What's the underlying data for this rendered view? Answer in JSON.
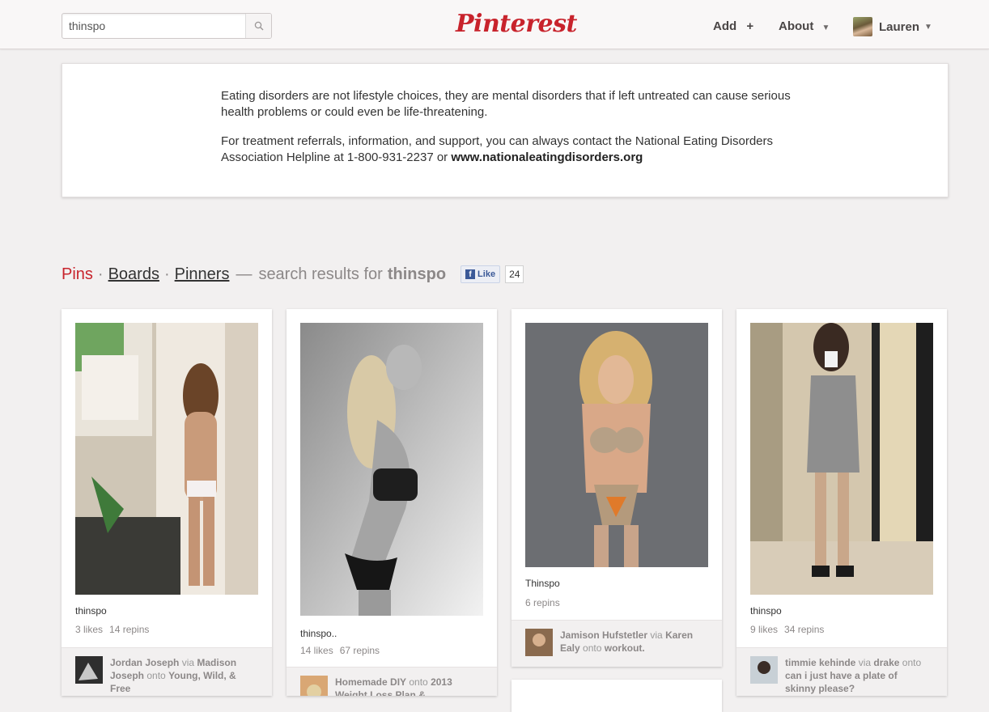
{
  "header": {
    "search_value": "thinspo",
    "search_icon": "search-icon",
    "logo": "Pinterest",
    "nav": {
      "add_label": "Add",
      "add_icon": "+",
      "about_label": "About",
      "user_name": "Lauren"
    }
  },
  "notice": {
    "para1": "Eating disorders are not lifestyle choices, they are mental disorders that if left untreated can cause serious health problems or could even be life-threatening.",
    "para2_text": "For treatment referrals, information, and support, you can always contact the National Eating Disorders Association Helpline at 1-800-931-2237 or ",
    "para2_link": "www.nationaleatingdisorders.org"
  },
  "results": {
    "tab_pins": "Pins",
    "tab_boards": "Boards",
    "tab_pinners": "Pinners",
    "dash": "—",
    "prefix": "search results for",
    "query": "thinspo",
    "fb_like": "Like",
    "fb_count": "24"
  },
  "pins": [
    {
      "description": "thinspo",
      "likes": "3 likes",
      "repins": "14 repins",
      "pinner": "Jordan Joseph",
      "via": "via",
      "via_user": "Madison Joseph",
      "onto": "onto",
      "board": "Young, Wild, & Free"
    },
    {
      "description": "thinspo..",
      "likes": "14 likes",
      "repins": "67 repins",
      "pinner": "Homemade DIY",
      "onto": "onto",
      "board": "2013 Weight Loss Plan &"
    },
    {
      "description": "Thinspo",
      "repins": "6 repins",
      "pinner": "Jamison Hufstetler",
      "via": "via",
      "via_user": "Karen Ealy",
      "onto": "onto",
      "board": "workout."
    },
    {
      "description": "thinspo",
      "likes": "9 likes",
      "repins": "34 repins",
      "pinner": "timmie kehinde",
      "via": "via",
      "via_user": "drake",
      "onto": "onto",
      "board": "can i just have a plate of skinny please?"
    }
  ],
  "colors": {
    "brand": "#c8232c",
    "background": "#f2f0f0"
  }
}
